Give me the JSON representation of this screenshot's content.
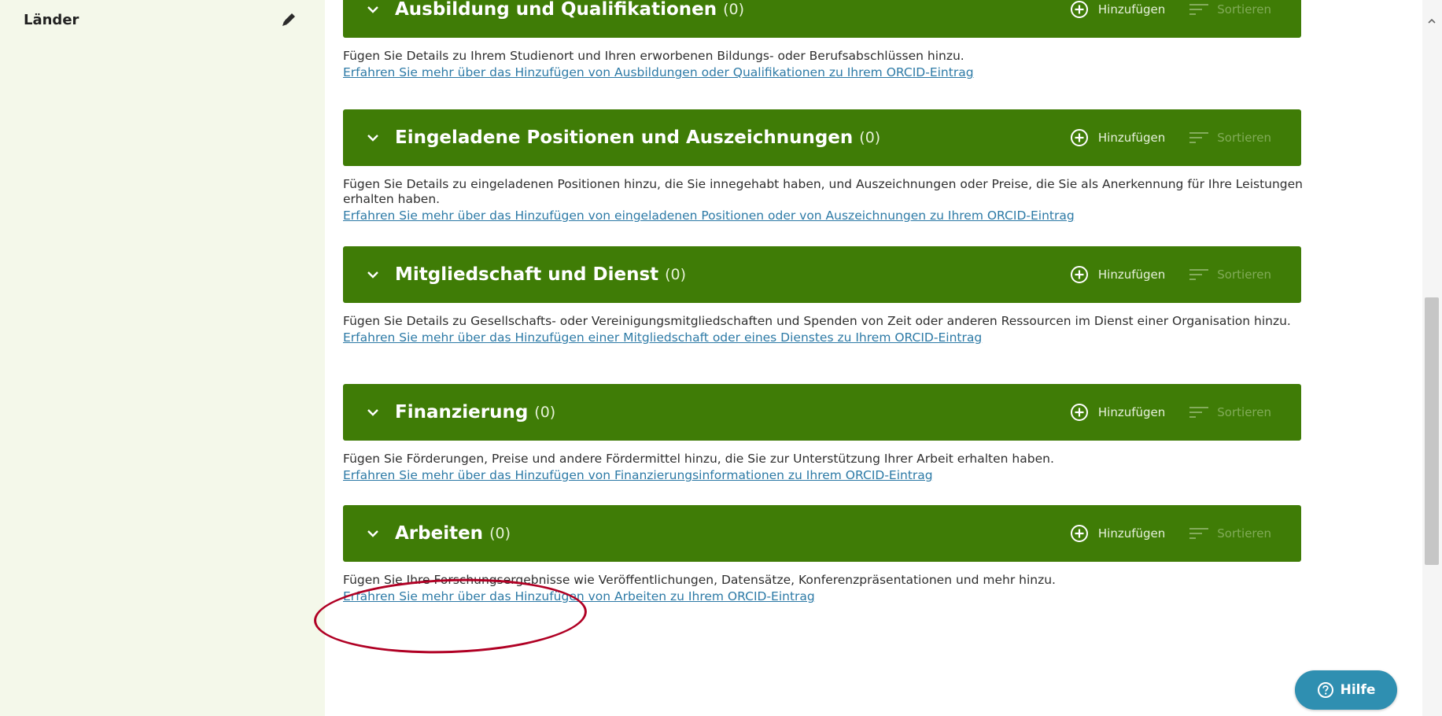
{
  "sidebar": {
    "label": "Länder"
  },
  "sections": [
    {
      "title": "Ausbildung und Qualifikationen",
      "count": "(0)",
      "add_label": "Hinzufügen",
      "sort_label": "Sortieren",
      "description": "Fügen Sie Details zu Ihrem Studienort und Ihren erworbenen Bildungs- oder Berufsabschlüssen hinzu.",
      "link": "Erfahren Sie mehr über das Hinzufügen von Ausbildungen oder Qualifikationen zu Ihrem ORCID-Eintrag"
    },
    {
      "title": "Eingeladene Positionen und Auszeichnungen",
      "count": "(0)",
      "add_label": "Hinzufügen",
      "sort_label": "Sortieren",
      "description": "Fügen Sie Details zu eingeladenen Positionen hinzu, die Sie innegehabt haben, und Auszeichnungen oder Preise, die Sie als Anerkennung für Ihre Leistungen erhalten haben.",
      "link": "Erfahren Sie mehr über das Hinzufügen von eingeladenen Positionen oder von Auszeichnungen zu Ihrem ORCID-Eintrag"
    },
    {
      "title": "Mitgliedschaft und Dienst",
      "count": "(0)",
      "add_label": "Hinzufügen",
      "sort_label": "Sortieren",
      "description": "Fügen Sie Details zu Gesellschafts- oder Vereinigungsmitgliedschaften und Spenden von Zeit oder anderen Ressourcen im Dienst einer Organisation hinzu.",
      "link": "Erfahren Sie mehr über das Hinzufügen einer Mitgliedschaft oder eines Dienstes zu Ihrem ORCID-Eintrag"
    },
    {
      "title": "Finanzierung",
      "count": "(0)",
      "add_label": "Hinzufügen",
      "sort_label": "Sortieren",
      "description": "Fügen Sie Förderungen, Preise und andere Fördermittel hinzu, die Sie zur Unterstützung Ihrer Arbeit erhalten haben.",
      "link": "Erfahren Sie mehr über das Hinzufügen von Finanzierungsinformationen zu Ihrem ORCID-Eintrag"
    },
    {
      "title": "Arbeiten",
      "count": "(0)",
      "add_label": "Hinzufügen",
      "sort_label": "Sortieren",
      "description": "Fügen Sie Ihre Forschungsergebnisse wie Veröffentlichungen, Datensätze, Konferenzpräsentationen und mehr hinzu.",
      "link": "Erfahren Sie mehr über das Hinzufügen von Arbeiten zu Ihrem ORCID-Eintrag"
    }
  ],
  "help": {
    "label": "Hilfe"
  },
  "colors": {
    "section_header": "#3f7c06",
    "sidebar_bg": "#f4f8ea",
    "link": "#2d7aa6",
    "help_button": "#2f8fb1",
    "highlight": "#b00024"
  }
}
